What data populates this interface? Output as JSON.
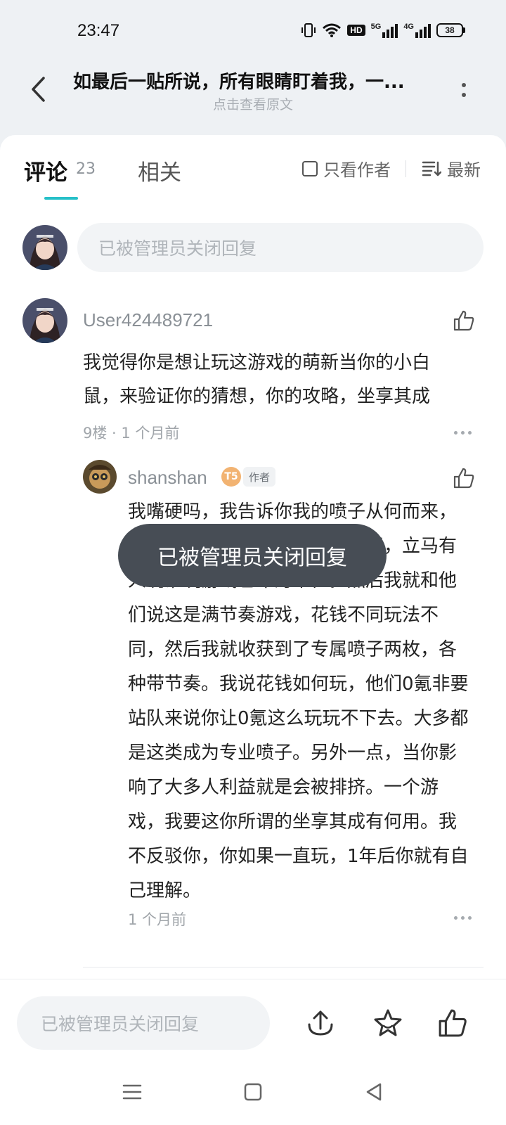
{
  "status_bar": {
    "time": "23:47",
    "battery": "38",
    "hd_label": "HD",
    "net1_label": "5G",
    "net2_label": "4G"
  },
  "header": {
    "title": "如最后一贴所说，所有眼睛盯着我，一...",
    "subtitle": "点击查看原文"
  },
  "tabs": {
    "comments_label": "评论",
    "comments_count": "23",
    "related_label": "相关",
    "author_only_label": "只看作者",
    "sort_label": "最新"
  },
  "reply_box": {
    "placeholder": "已被管理员关闭回复"
  },
  "comment": {
    "username": "User424489721",
    "text": "我觉得你是想让玩这游戏的萌新当你的小白鼠，来验证你的猜想，你的攻略，坐享其成",
    "meta": "9楼 · 1 个月前"
  },
  "reply": {
    "username": "shanshan",
    "level": "T5",
    "author_badge": "作者",
    "text": "我嘴硬吗，我告诉你我的喷子从何而来，我当初只是问了一下花钱如何玩，立马有人说谁玩游戏已年为单位。然后我就和他们说这是满节奏游戏，花钱不同玩法不同，然后我就收获到了专属喷子两枚，各种带节奏。我说花钱如何玩，他们0氪非要站队来说你让0氪这么玩玩不下去。大多都是这类成为专业喷子。另外一点，当你影响了大多人利益就是会被排挤。一个游戏，我要这你所谓的坐享其成有何用。我不反驳你，你如果一直玩，1年后你就有自己理解。",
    "meta": "1 个月前"
  },
  "toast": {
    "text": "已被管理员关闭回复"
  },
  "bottom_bar": {
    "input_placeholder": "已被管理员关闭回复"
  },
  "colors": {
    "accent": "#26c0c8",
    "toast_bg": "#474d55",
    "level_badge": "#f2b372"
  },
  "icons": [
    "back-icon",
    "more-icon",
    "checkbox-icon",
    "sort-icon",
    "like-icon",
    "share-icon",
    "star-icon",
    "menu-icon",
    "home-icon",
    "back-triangle-icon"
  ]
}
